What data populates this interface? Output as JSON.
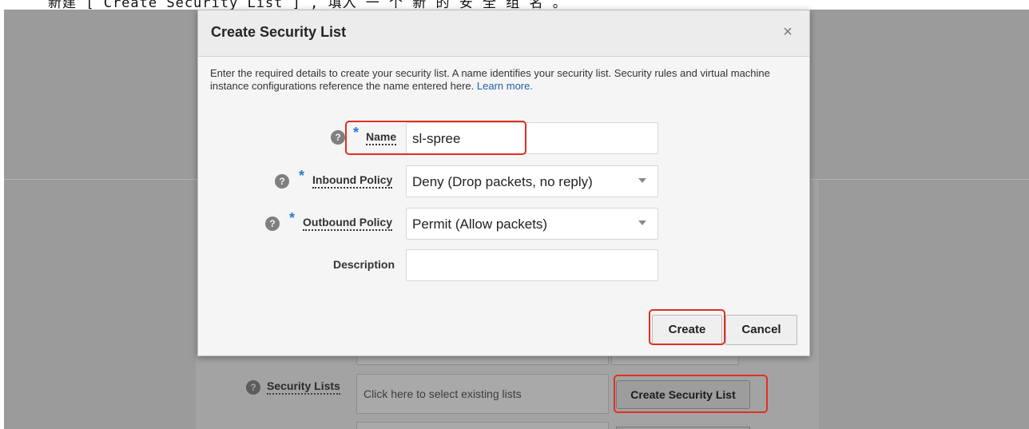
{
  "top_caption": "新建 [ Create Security List ] , 填入 一 个 新 的 安 全 组 名 。",
  "background": {
    "security_lists_label": "Security Lists",
    "security_lists_placeholder": "Click here to select existing lists",
    "create_security_list_button": "Create Security List",
    "help_glyph": "?"
  },
  "modal": {
    "title": "Create Security List",
    "close_glyph": "×",
    "intro": "Enter the required details to create your security list. A name identifies your security list. Security rules and virtual machine instance configurations reference the name entered here.",
    "learn_more": "Learn more.",
    "required_marker": "*",
    "help_glyph": "?",
    "fields": {
      "name": {
        "label": "Name",
        "value": "sl-spree"
      },
      "inbound_policy": {
        "label": "Inbound Policy",
        "value": "Deny (Drop packets, no reply)"
      },
      "outbound_policy": {
        "label": "Outbound Policy",
        "value": "Permit (Allow packets)"
      },
      "description": {
        "label": "Description",
        "value": ""
      }
    },
    "buttons": {
      "create": "Create",
      "cancel": "Cancel"
    }
  },
  "colors": {
    "overlay": "#9b9b9b",
    "highlight": "#e0301f",
    "link": "#1f5ea8",
    "required": "#2b7bd0"
  }
}
